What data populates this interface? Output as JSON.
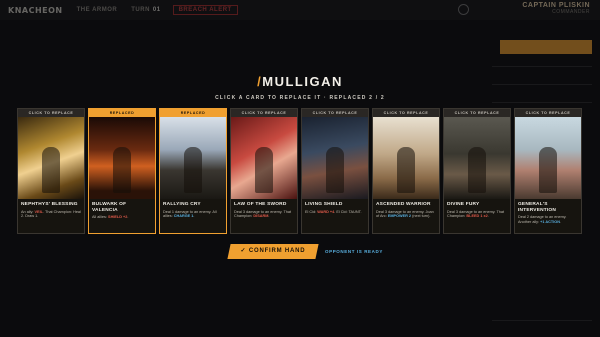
{
  "app": {
    "logo": "KNACHEON",
    "tab_armor": "THE ARMOR",
    "tab_turn": "TURN",
    "tab_turn_num": "01",
    "tab_alert": "BREACH ALERT",
    "player_name": "CAPTAIN PLISKIN",
    "player_sub": "COMMANDER"
  },
  "mulligan": {
    "title": "MULLIGAN",
    "instruction": "CLICK A CARD TO REPLACE IT · REPLACED 2 / 2",
    "confirm_label": "CONFIRM HAND",
    "opponent_status": "OPPONENT IS READY"
  },
  "cards": [
    {
      "badge": "CLICK TO REPLACE",
      "name": "NEPHTHYS' BLESSING",
      "desc_a": "An ally: ",
      "kw": "VEIL",
      "kw_class": "kw-red",
      "desc_b": ". That Champion: Heal 2. Draw 1.",
      "replaced": false,
      "art": "gold"
    },
    {
      "badge": "REPLACED",
      "name": "BULWARK OF VALENCIA",
      "desc_a": "All allies: ",
      "kw": "SHIELD +2",
      "kw_class": "kw-red",
      "desc_b": ".",
      "replaced": true,
      "art": "ember"
    },
    {
      "badge": "REPLACED",
      "name": "RALLYING CRY",
      "desc_a": "Deal 1 damage to an enemy. All allies: ",
      "kw": "CHARGE 1",
      "kw_class": "kw-blue",
      "desc_b": ".",
      "replaced": true,
      "art": "sky"
    },
    {
      "badge": "CLICK TO REPLACE",
      "name": "LAW OF THE SWORD",
      "desc_a": "Deal 3 damage to an enemy. That Champion: ",
      "kw": "DISARM",
      "kw_class": "kw-red",
      "desc_b": ".",
      "replaced": false,
      "art": "crimson"
    },
    {
      "badge": "CLICK TO REPLACE",
      "name": "LIVING SHIELD",
      "desc_a": "El Cid: ",
      "kw": "WARD +4",
      "kw_class": "kw-red",
      "desc_b": ". El Cid: TAUNT.",
      "replaced": false,
      "art": "steel"
    },
    {
      "badge": "CLICK TO REPLACE",
      "name": "ASCENDED WARRIOR",
      "desc_a": "Deal 3 damage to an enemy. Joan of Arc: ",
      "kw": "EMPOWER 2",
      "kw_class": "kw-blue",
      "desc_b": " (next turn).",
      "replaced": false,
      "art": "dawn"
    },
    {
      "badge": "CLICK TO REPLACE",
      "name": "DIVINE FURY",
      "desc_a": "Deal 3 damage to an enemy. That Champion: ",
      "kw": "BLEED 1 x2",
      "kw_class": "kw-red",
      "desc_b": ".",
      "replaced": false,
      "art": "army"
    },
    {
      "badge": "CLICK TO REPLACE",
      "name": "GENERAL'S INTERVENTION",
      "desc_a": "Deal 2 damage to an enemy. Another ally: ",
      "kw": "+1 ACTION",
      "kw_class": "kw-blue",
      "desc_b": ".",
      "replaced": false,
      "art": "pale"
    }
  ],
  "colors": {
    "accent": "#f0a030",
    "keyword_red": "#e05a4a",
    "keyword_blue": "#5ab0e0"
  }
}
